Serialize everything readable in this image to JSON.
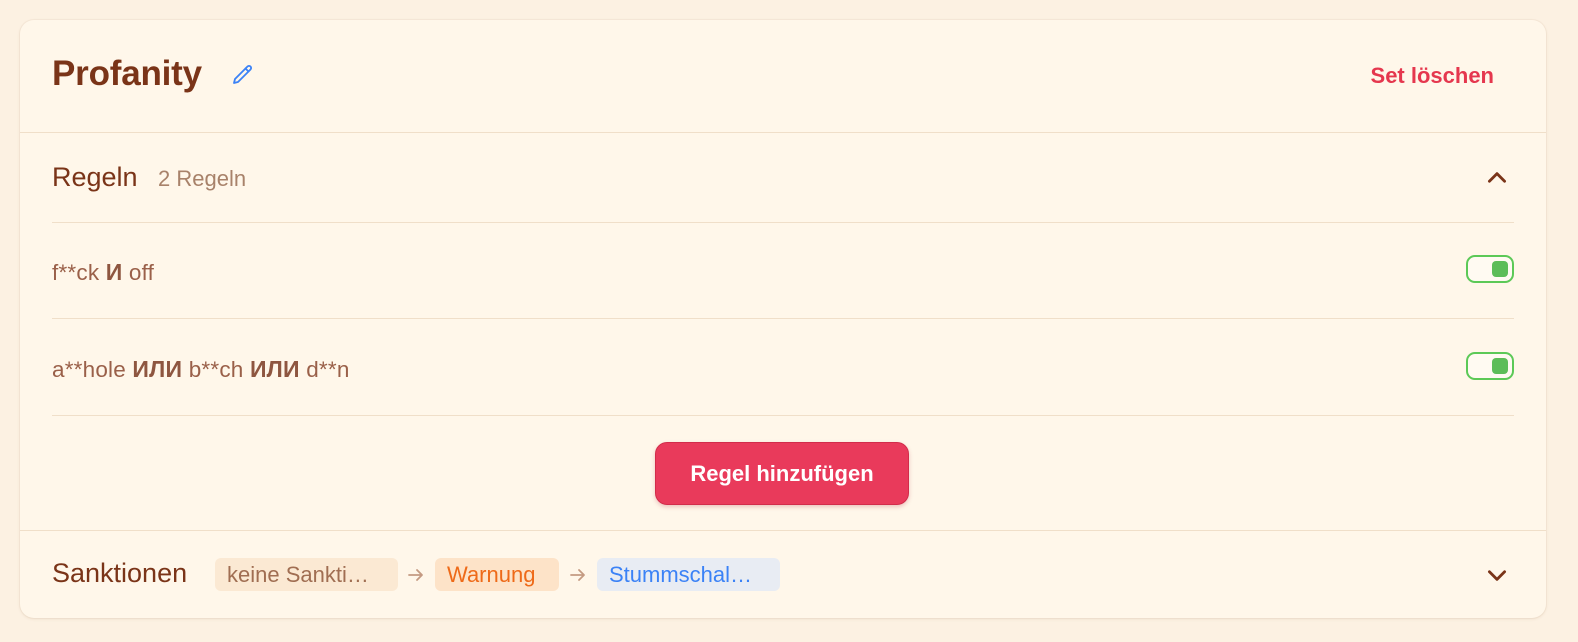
{
  "header": {
    "title": "Profanity",
    "delete_label": "Set löschen"
  },
  "rules": {
    "title": "Regeln",
    "count": "2 Regeln",
    "items": [
      {
        "parts": [
          "f**ck",
          "И",
          "off"
        ],
        "enabled": true
      },
      {
        "parts": [
          "a**hole",
          "ИЛИ",
          "b**ch",
          "ИЛИ",
          "d**n"
        ],
        "enabled": true
      }
    ],
    "add_label": "Regel hinzufügen"
  },
  "sanctions": {
    "title": "Sanktionen",
    "chips": [
      {
        "label": "keine Sankti…"
      },
      {
        "label": "Warnung"
      },
      {
        "label": "Stummschal…"
      }
    ]
  },
  "colors": {
    "background": "#fcf1e2",
    "card": "#fff7ea",
    "title": "#7a3418",
    "danger": "#e5374e",
    "primary_button": "#e93a5b",
    "toggle_on": "#5cc957",
    "warning": "#ee6a18",
    "info": "#3b82f6"
  },
  "icons": {
    "edit": "pencil-icon",
    "collapse": "chevron-up-icon",
    "expand": "chevron-down-icon",
    "arrow": "arrow-right-icon"
  }
}
